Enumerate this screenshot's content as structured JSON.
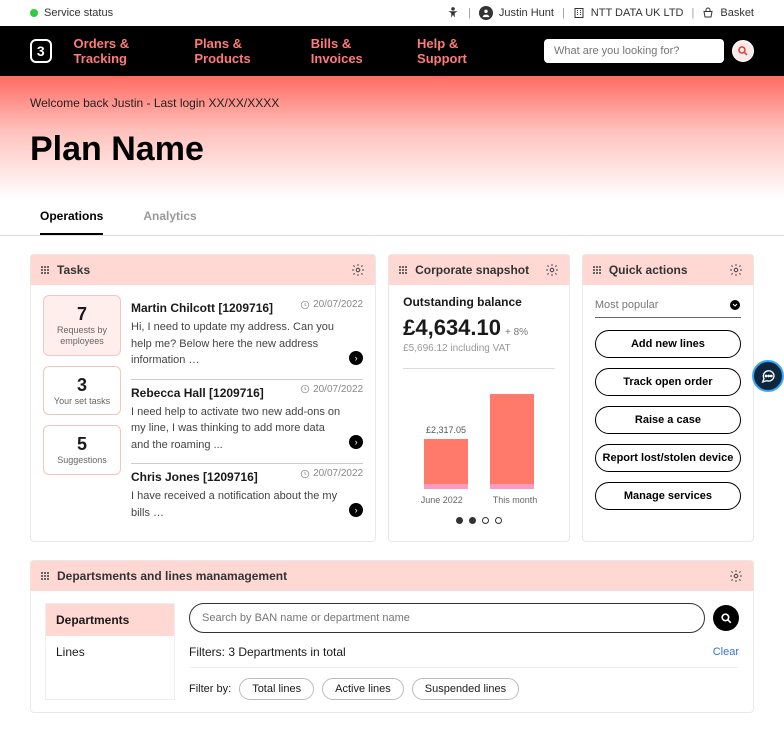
{
  "topbar": {
    "status": "Service status",
    "user": "Justin Hunt",
    "company": "NTT DATA UK LTD",
    "basket": "Basket"
  },
  "nav": {
    "items": [
      "Orders & Tracking",
      "Plans & Products",
      "Bills & Invoices",
      "Help & Support"
    ],
    "search_placeholder": "What are you looking for?"
  },
  "hero": {
    "welcome": "Welcome back Justin - Last login XX/XX/XXXX",
    "plan_title": "Plan Name"
  },
  "tabs": [
    "Operations",
    "Analytics"
  ],
  "tasks": {
    "title": "Tasks",
    "buckets": [
      {
        "count": "7",
        "label": "Requests by employees"
      },
      {
        "count": "3",
        "label": "Your set tasks"
      },
      {
        "count": "5",
        "label": "Suggestions"
      }
    ],
    "items": [
      {
        "name": "Martin Chilcott [1209716]",
        "date": "20/07/2022",
        "body": "Hi, I need to update my address. Can you help me? Below here the new address information …"
      },
      {
        "name": "Rebecca Hall [1209716]",
        "date": "20/07/2022",
        "body": "I need help to activate two new add-ons on my line, I was thinking to add more data and the roaming ..."
      },
      {
        "name": "Chris Jones [1209716]",
        "date": "20/07/2022",
        "body": "I have received a notification about the my bills …"
      }
    ]
  },
  "snapshot": {
    "title": "Corporate snapshot",
    "label": "Outstanding balance",
    "amount": "£4,634.10",
    "delta": "+ 8%",
    "sub": "£5,696.12 including VAT",
    "bar_value": "£2,317.05",
    "labels": [
      "June 2022",
      "This month"
    ]
  },
  "quick": {
    "title": "Quick actions",
    "filter": "Most popular",
    "buttons": [
      "Add new lines",
      "Track open order",
      "Raise a case",
      "Report lost/stolen device",
      "Manage services"
    ]
  },
  "dept": {
    "title": "Departsments and lines manamagement",
    "side": [
      "Departments",
      "Lines"
    ],
    "search_placeholder": "Search by BAN name or department name",
    "filters_label": "Filters: 3 Departments in total",
    "clear": "Clear",
    "filter_by": "Filter by:",
    "chips": [
      "Total lines",
      "Active lines",
      "Suspended lines"
    ]
  },
  "chart_data": {
    "type": "bar",
    "title": "Outstanding balance",
    "categories": [
      "June 2022",
      "This month"
    ],
    "values": [
      2317.05,
      4634.1
    ],
    "currency": "GBP",
    "ylim": [
      0,
      5000
    ],
    "annotations": [
      {
        "index": 0,
        "label": "£2,317.05"
      }
    ]
  }
}
